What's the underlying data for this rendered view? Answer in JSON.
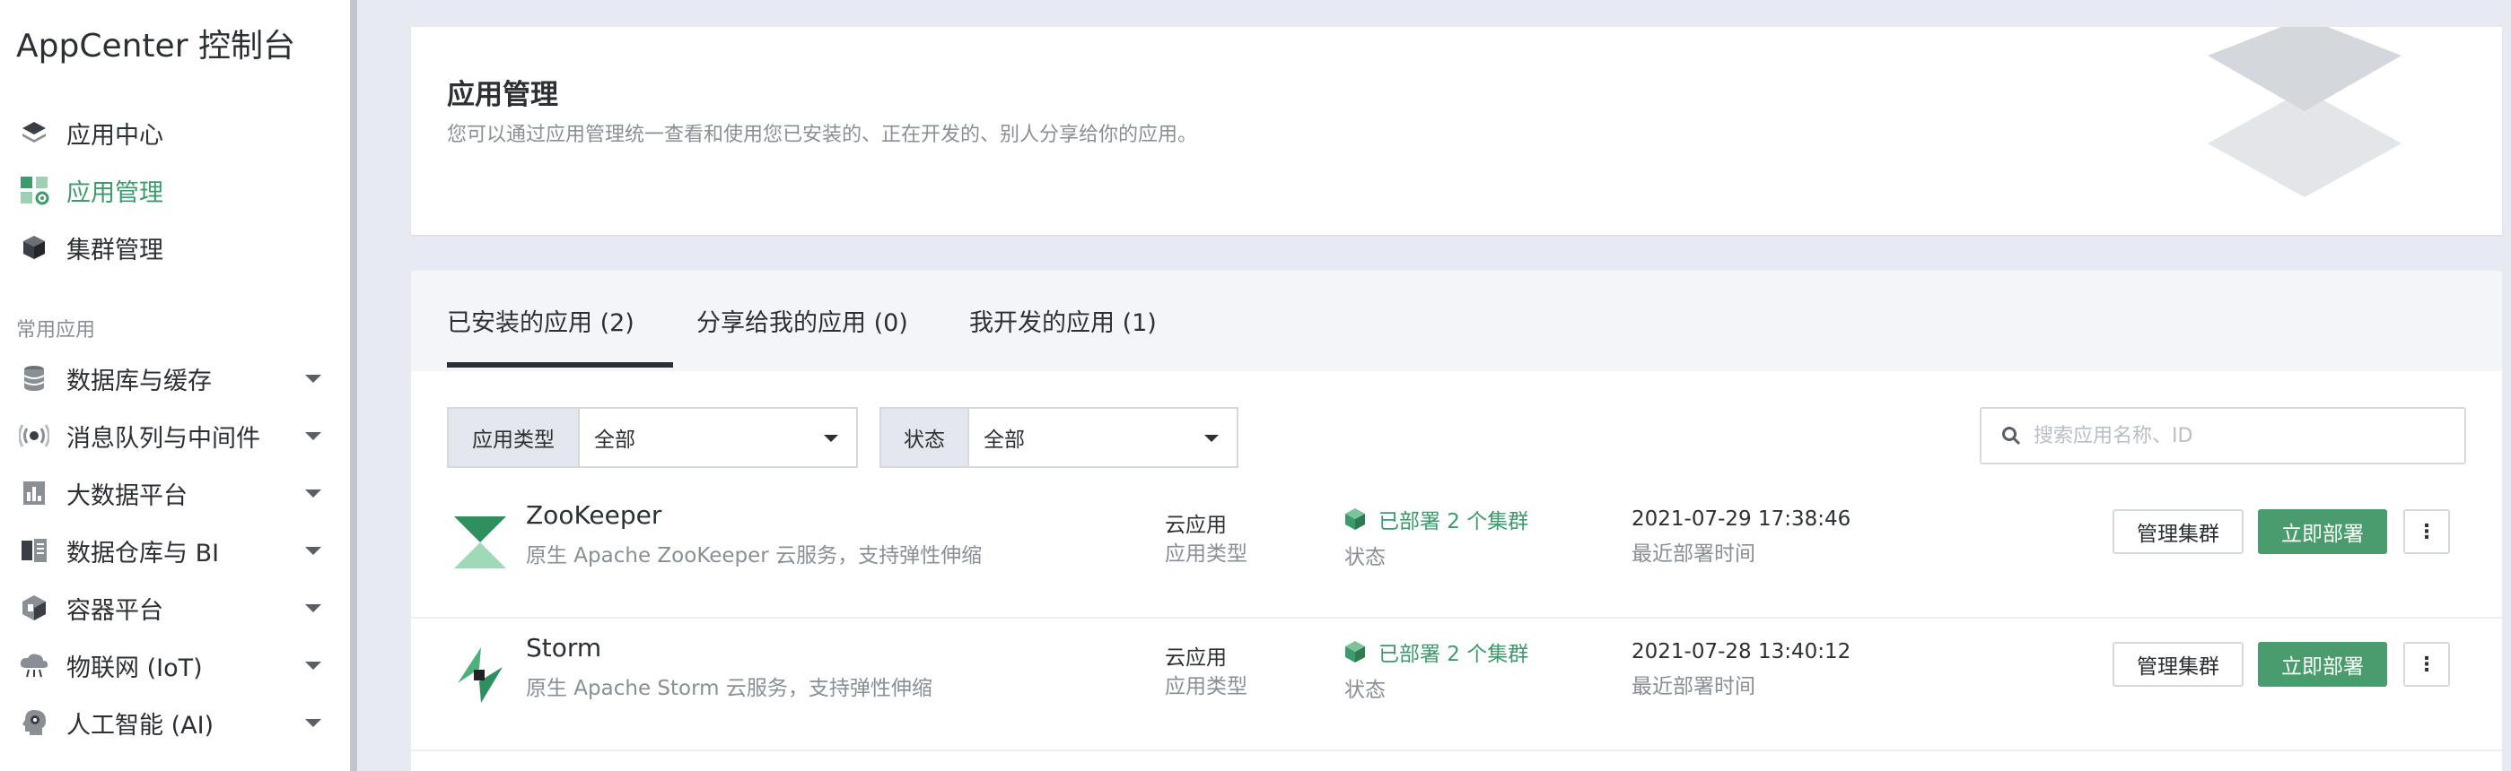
{
  "sidebar": {
    "app_title": "AppCenter 控制台",
    "items": [
      {
        "label": "应用中心",
        "icon": "stack-icon"
      },
      {
        "label": "应用管理",
        "icon": "grid-gear-icon",
        "active": true
      },
      {
        "label": "集群管理",
        "icon": "cube-icon"
      }
    ],
    "section_label": "常用应用",
    "categories": [
      {
        "label": "数据库与缓存",
        "icon": "database-icon"
      },
      {
        "label": "消息队列与中间件",
        "icon": "broadcast-icon"
      },
      {
        "label": "大数据平台",
        "icon": "bar-chart-icon"
      },
      {
        "label": "数据仓库与 BI",
        "icon": "book-icon"
      },
      {
        "label": "容器平台",
        "icon": "container-icon"
      },
      {
        "label": "物联网 (IoT)",
        "icon": "cloud-iot-icon"
      },
      {
        "label": "人工智能 (AI)",
        "icon": "ai-head-icon"
      }
    ]
  },
  "header": {
    "title": "应用管理",
    "description": "您可以通过应用管理统一查看和使用您已安装的、正在开发的、别人分享给你的应用。"
  },
  "tabs": [
    {
      "label": "已安装的应用 (2)",
      "active": true
    },
    {
      "label": "分享给我的应用 (0)"
    },
    {
      "label": "我开发的应用 (1)"
    }
  ],
  "filters": {
    "type_label": "应用类型",
    "type_value": "全部",
    "status_label": "状态",
    "status_value": "全部"
  },
  "search": {
    "placeholder": "搜索应用名称、ID"
  },
  "apps": [
    {
      "name": "ZooKeeper",
      "description": "原生 Apache ZooKeeper 云服务，支持弹性伸缩",
      "type_value": "云应用",
      "type_caption": "应用类型",
      "status_value": "已部署 2 个集群",
      "status_caption": "状态",
      "deploy_time": "2021-07-29 17:38:46",
      "deploy_caption": "最近部署时间",
      "manage_label": "管理集群",
      "deploy_label": "立即部署",
      "more_label": "⋮"
    },
    {
      "name": "Storm",
      "description": "原生 Apache Storm 云服务，支持弹性伸缩",
      "type_value": "云应用",
      "type_caption": "应用类型",
      "status_value": "已部署 2 个集群",
      "status_caption": "状态",
      "deploy_time": "2021-07-28 13:40:12",
      "deploy_caption": "最近部署时间",
      "manage_label": "管理集群",
      "deploy_label": "立即部署",
      "more_label": "⋮"
    }
  ],
  "colors": {
    "accent": "#3d9a6c",
    "primary_button": "#4a9b6d",
    "page_bg": "#e7ebf1",
    "sidebar_divider": "#c2c6cc"
  }
}
